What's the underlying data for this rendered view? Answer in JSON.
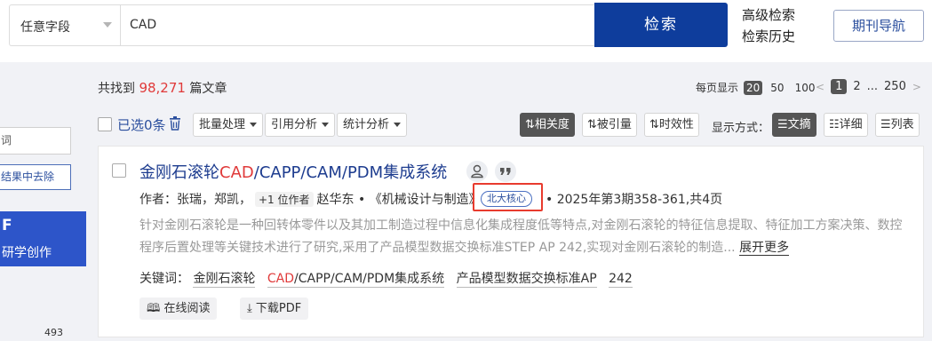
{
  "search": {
    "field_label": "任意字段",
    "query": "CAD",
    "button_label": "检索",
    "advanced_label": "高级检索",
    "history_label": "检索历史",
    "journal_nav_label": "期刊导航"
  },
  "sidebar": {
    "input_fragment": "词",
    "remove_button_fragment": "结果中去除",
    "banner_title_fragment": "F",
    "banner_subtitle_fragment": "研学创作",
    "count": "493"
  },
  "results_header": {
    "found_prefix": "共找到",
    "found_count": "98,271",
    "found_suffix": "篇文章",
    "per_page_label": "每页显示",
    "per_page_options": [
      "20",
      "50",
      "100"
    ],
    "per_page_selected": "20",
    "pagination": {
      "prev": "<",
      "current": "1",
      "next_page": "2",
      "ellipsis": "...",
      "last": "250",
      "next": ">"
    }
  },
  "toolbar": {
    "selected_label": "已选0条",
    "batch_label": "批量处理",
    "cite_label": "引用分析",
    "stats_label": "统计分析",
    "sort_relevance": "相关度",
    "sort_cited": "被引量",
    "sort_recency": "时效性",
    "display_label": "显示方式：",
    "display_abstract": "文摘",
    "display_detail": "详细",
    "display_list": "列表"
  },
  "result": {
    "title_pre": "金刚石滚轮",
    "title_hl": "CAD",
    "title_post": "/CAPP/CAM/PDM集成系统",
    "authors_label": "作者：",
    "authors": "张瑞，郑凯，",
    "more_authors": "+1 位作者",
    "author_extra": "赵华东",
    "journal": "《机械设计与制造》",
    "core_tag": "北大核心",
    "issue": "• 2025年第3期358-361,共4页",
    "abstract": "针对金刚石滚轮是一种回转体零件以及其加工制造过程中信息化集成程度低等特点,对金刚石滚轮的特征信息提取、特征加工方案决策、数控程序后置处理等关键技术进行了研究,采用了产品模型数据交换标准STEP AP 242,实现对金刚石滚轮的制造...",
    "expand_label": "展开更多",
    "keywords_label": "关键词：",
    "keywords": [
      "金刚石滚轮",
      "CAD/CAPP/CAM/PDM集成系统",
      "产品模型数据交换标准AP",
      "242"
    ],
    "keyword_hl": "CAD",
    "keyword_hl_rest": "/CAPP/CAM/PDM集成系统",
    "read_online_label": "在线阅读",
    "download_label": "下载PDF"
  }
}
